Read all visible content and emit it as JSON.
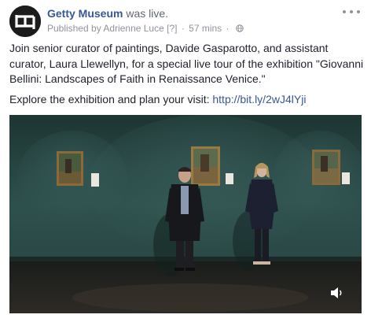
{
  "header": {
    "page_name": "Getty Museum",
    "status": "was live.",
    "published_by": "Published by Adrienne Luce",
    "edit_marker": "[?]",
    "time": "57 mins",
    "separator": "·"
  },
  "post": {
    "paragraph_1": "Join senior curator of paintings, Davide Gasparotto, and assistant curator, Laura Llewellyn, for a special live tour of the exhibition \"Giovanni Bellini: Landscapes of Faith in Renaissance Venice.\"",
    "paragraph_2_text": "Explore the exhibition and plan your visit: ",
    "paragraph_2_link": "http://bit.ly/2wJ4lYji"
  },
  "icons": {
    "avatar": "getty-logo-icon",
    "audience": "globe-icon",
    "more": "more-options-icon",
    "volume": "speaker-icon"
  },
  "colors": {
    "link": "#365899",
    "meta": "#90949c",
    "text": "#1d2129",
    "wall": "#2a4a47"
  }
}
